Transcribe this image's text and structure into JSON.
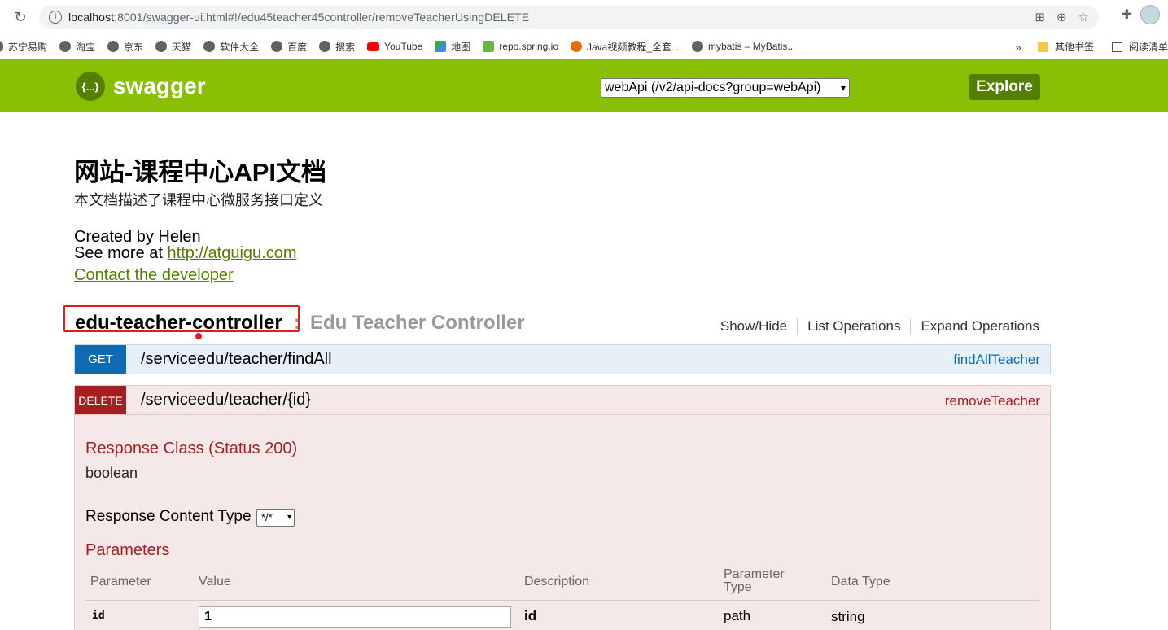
{
  "browser": {
    "url_host": "localhost",
    "url_rest": ":8001/swagger-ui.html#!/edu45teacher45controller/removeTeacherUsingDELETE",
    "bookmarks": [
      "苏宁易购",
      "淘宝",
      "京东",
      "天猫",
      "软件大全",
      "百度",
      "搜索",
      "YouTube",
      "地图",
      "repo.spring.io",
      "Java视频教程_全套...",
      "mybatis – MyBatis..."
    ],
    "bookmarks_more": "»",
    "other_bookmarks": "其他书签",
    "reading_list": "阅读清单"
  },
  "header": {
    "logo_text": "swagger",
    "logo_mark": "{...}",
    "api_select": "webApi (/v2/api-docs?group=webApi)",
    "explore_label": "Explore",
    "brand_color": "#89bf04"
  },
  "info": {
    "title": "网站-课程中心API文档",
    "description": "本文档描述了课程中心微服务接口定义",
    "created_by": "Created by Helen",
    "see_more_prefix": "See more at ",
    "see_more_link": "http://atguigu.com",
    "contact": "Contact the developer"
  },
  "resource": {
    "name": "edu-teacher-controller",
    "separator": ":",
    "description": "Edu Teacher Controller",
    "ops": [
      "Show/Hide",
      "List Operations",
      "Expand Operations"
    ]
  },
  "operations": [
    {
      "method": "GET",
      "path": "/serviceedu/teacher/findAll",
      "nickname": "findAllTeacher"
    },
    {
      "method": "DELETE",
      "path": "/serviceedu/teacher/{id}",
      "nickname": "removeTeacher"
    }
  ],
  "delete_detail": {
    "response_class_label": "Response Class (Status 200)",
    "response_type": "boolean",
    "response_content_type_label": "Response Content Type",
    "response_content_type_value": "*/*",
    "parameters_label": "Parameters",
    "table_headers": [
      "Parameter",
      "Value",
      "Description",
      "Parameter Type",
      "Data Type"
    ],
    "rows": [
      {
        "parameter": "id",
        "value": "1",
        "description": "id",
        "parameter_type": "path",
        "data_type": "string"
      }
    ]
  }
}
